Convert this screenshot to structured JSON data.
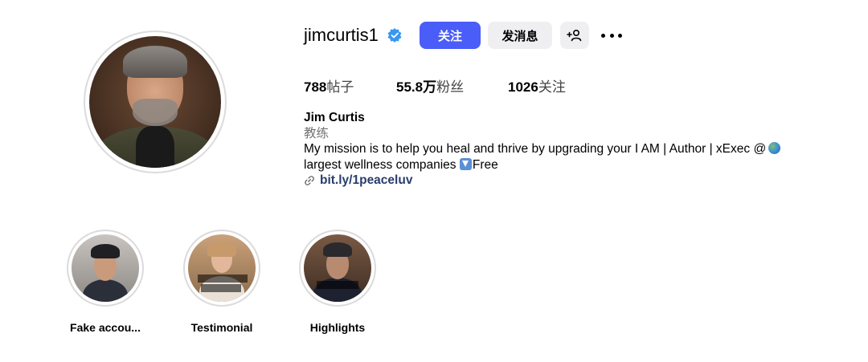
{
  "profile": {
    "username": "jimcurtis1",
    "verified": true,
    "follow_label": "关注",
    "message_label": "发消息",
    "add_user_icon": "person-plus-icon",
    "more_icon": "more-horizontal-icon"
  },
  "stats": {
    "posts_count": "788",
    "posts_label": "帖子",
    "followers_count": "55.8万",
    "followers_label": "粉丝",
    "following_count": "1026",
    "following_label": "关注"
  },
  "bio": {
    "name": "Jim Curtis",
    "category": "教练",
    "line1": "My mission is to help you heal and thrive by upgrading your I AM | Author | xExec @",
    "line2_start": "largest wellness companies",
    "line2_end": "Free",
    "link": "bit.ly/1peaceluv"
  },
  "highlights": [
    {
      "label": "Fake accou..."
    },
    {
      "label": "Testimonial"
    },
    {
      "label": "Highlights"
    }
  ],
  "colors": {
    "follow_button": "#4a5df9",
    "secondary_button": "#efeff1",
    "verified_badge": "#3897f0",
    "link": "#2a3d6b"
  }
}
